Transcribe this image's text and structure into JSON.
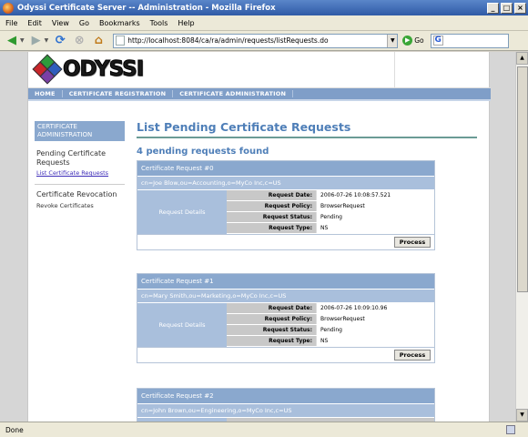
{
  "window": {
    "title": "Odyssi Certificate Server -- Administration - Mozilla Firefox",
    "minimize": "_",
    "maximize": "□",
    "close": "×"
  },
  "menu": [
    "File",
    "Edit",
    "View",
    "Go",
    "Bookmarks",
    "Tools",
    "Help"
  ],
  "toolbar": {
    "url": "http://localhost:8084/ca/ra/admin/requests/listRequests.do",
    "go_label": "Go",
    "search_logo": "G"
  },
  "header": {
    "logo_text": "ODYSSI",
    "nav": [
      "HOME",
      "CERTIFICATE REGISTRATION",
      "CERTIFICATE ADMINISTRATION"
    ]
  },
  "sidebar": {
    "heading": "CERTIFICATE ADMINISTRATION",
    "sections": [
      {
        "title": "Pending Certificate Requests",
        "link": "List Certificate Requests"
      },
      {
        "title": "Certificate Revocation",
        "link": "Revoke Certificates"
      }
    ]
  },
  "main": {
    "title": "List Pending Certificate Requests",
    "subtitle": "4 pending requests found",
    "details_label": "Request Details",
    "process_label": "Process",
    "field_labels": {
      "date": "Request Date:",
      "policy": "Request Policy:",
      "status": "Request Status:",
      "type": "Request Type:"
    },
    "requests": [
      {
        "header": "Certificate Request #0",
        "dn": "cn=Joe Blow,ou=Accounting,o=MyCo Inc,c=US",
        "date": "2006-07-26 10:08:57.521",
        "policy": "BrowserRequest",
        "status": "Pending",
        "type": "NS"
      },
      {
        "header": "Certificate Request #1",
        "dn": "cn=Mary Smith,ou=Marketing,o=MyCo Inc,c=US",
        "date": "2006-07-26 10:09:10.96",
        "policy": "BrowserRequest",
        "status": "Pending",
        "type": "NS"
      },
      {
        "header": "Certificate Request #2",
        "dn": "cn=John Brown,ou=Engineering,o=MyCo Inc,c=US"
      }
    ]
  },
  "status": {
    "text": "Done"
  }
}
